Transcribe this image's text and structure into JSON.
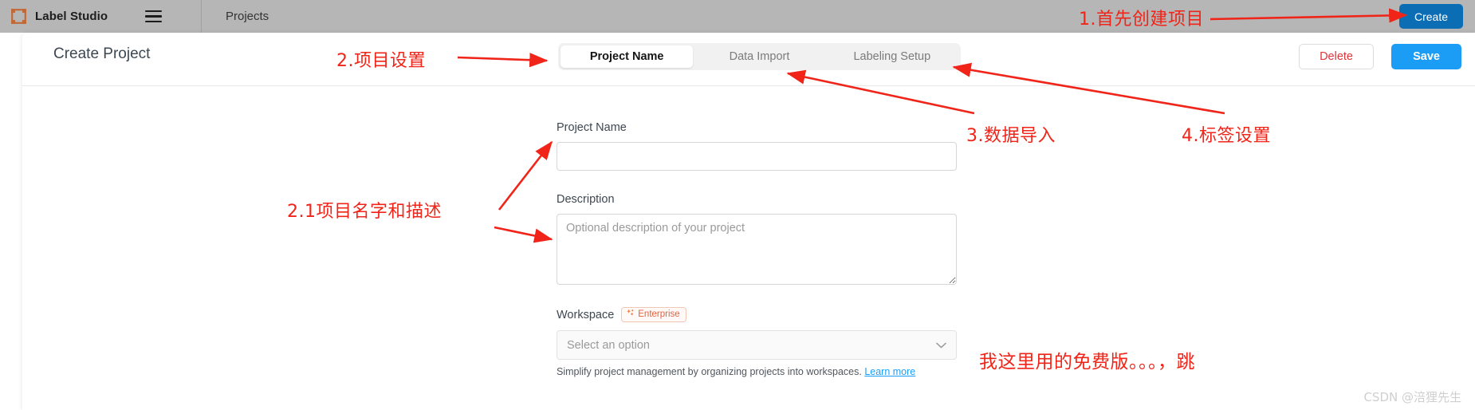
{
  "header": {
    "brand": "Label Studio",
    "logo_icon": "label-studio-logo-icon",
    "menu_icon": "hamburger-menu-icon",
    "breadcrumb": "Projects",
    "create_label": "Create",
    "create_color": "#0b6eb5",
    "bar_color": "#b6b6b6"
  },
  "modal": {
    "title": "Create Project",
    "tabs": [
      {
        "label": "Project Name",
        "active": true
      },
      {
        "label": "Data Import",
        "active": false
      },
      {
        "label": "Labeling Setup",
        "active": false
      }
    ],
    "delete_label": "Delete",
    "delete_color": "#e0333a",
    "save_label": "Save",
    "save_color": "#1c9df5"
  },
  "form": {
    "project_name": {
      "label": "Project Name",
      "value": "",
      "placeholder": ""
    },
    "description": {
      "label": "Description",
      "value": "",
      "placeholder": "Optional description of your project"
    },
    "workspace": {
      "label": "Workspace",
      "badge": "Enterprise",
      "badge_icon": "sparkle-icon",
      "badge_color": "#e2603c",
      "select_value": "Select an option",
      "chevron_icon": "chevron-down-icon",
      "helper_text": "Simplify project management by organizing projects into workspaces.",
      "helper_link": "Learn more",
      "helper_link_color": "#1c9df5"
    }
  },
  "annotations": {
    "color": "#f02418",
    "step1": "1.首先创建项目",
    "step2": "2.项目设置",
    "step3": "3.数据导入",
    "step4": "4.标签设置",
    "step21": "2.1项目名字和描述",
    "free_note": "我这里用的免费版。。。，跳"
  },
  "watermark": "CSDN @涪狸先生"
}
